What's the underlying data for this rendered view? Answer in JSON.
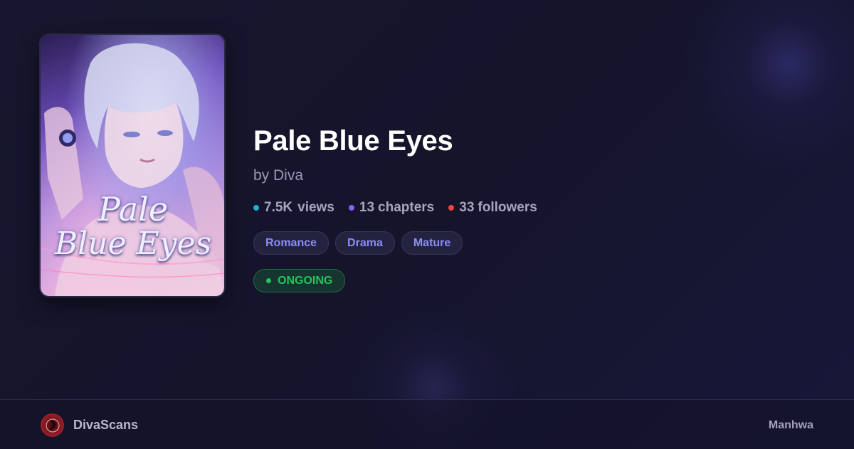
{
  "series": {
    "title": "Pale Blue Eyes",
    "author": "by Diva",
    "cover_title_line1": "Pale",
    "cover_title_line2": "Blue Eyes"
  },
  "stats": {
    "views": {
      "value": "7.5K",
      "label": "views",
      "color": "#1fb0d6"
    },
    "chapters": {
      "value": "13",
      "label": "chapters",
      "color": "#8b5cf6"
    },
    "followers": {
      "value": "33",
      "label": "followers",
      "color": "#ef4444"
    }
  },
  "tags": [
    {
      "label": "Romance"
    },
    {
      "label": "Drama"
    },
    {
      "label": "Mature"
    }
  ],
  "tag_color": "#8b8cf8",
  "status": {
    "label": "ONGOING",
    "color": "#22c55e"
  },
  "footer": {
    "brand": "DivaScans",
    "type": "Manhwa"
  },
  "icons": {
    "logo": "divascans-logo-icon",
    "status_dot": "status-dot-icon"
  }
}
